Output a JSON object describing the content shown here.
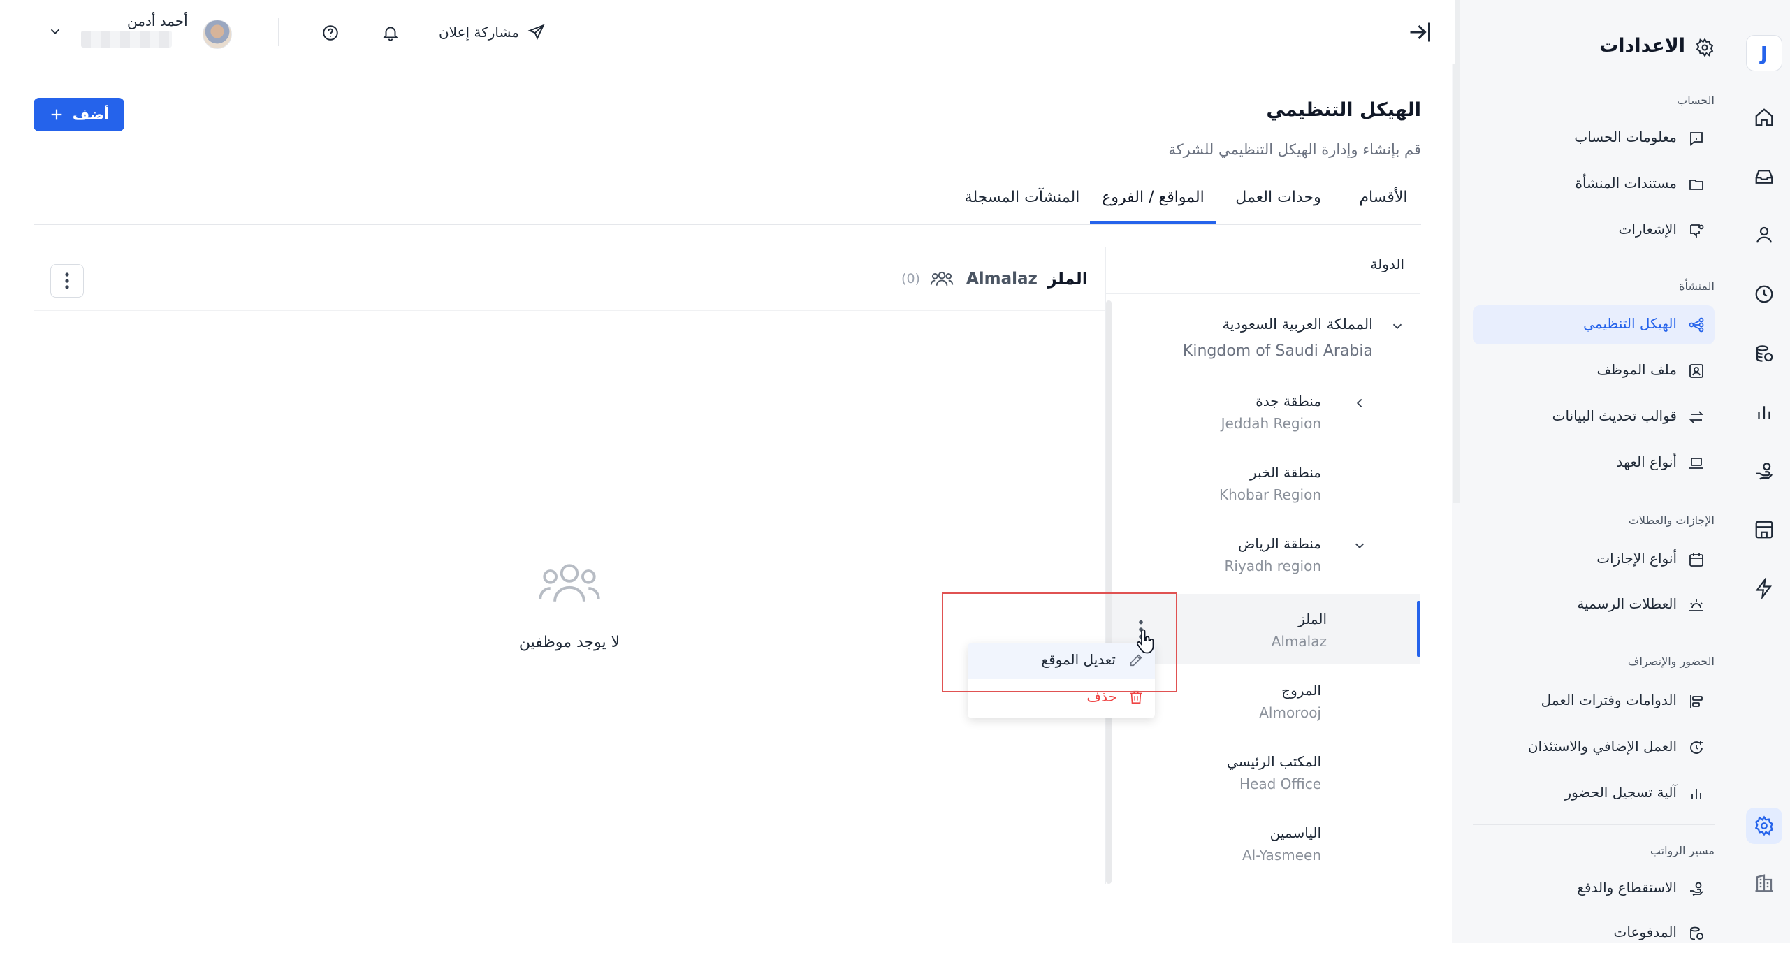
{
  "sidebar": {
    "title": "الاعدادات",
    "sections": [
      {
        "label": "الحساب"
      },
      {
        "label": "المنشأة"
      },
      {
        "label": "الإجازات والعطلات"
      },
      {
        "label": "الحضور والإنصراف"
      },
      {
        "label": "مسير الرواتب"
      }
    ],
    "items": [
      {
        "label": "معلومات الحساب"
      },
      {
        "label": "مستندات المنشأة"
      },
      {
        "label": "الإشعارات"
      },
      {
        "label": "الهيكل التنظيمي",
        "active": true
      },
      {
        "label": "ملف الموظف"
      },
      {
        "label": "قوالب تحديث البيانات"
      },
      {
        "label": "أنواع العهد"
      },
      {
        "label": "أنواع الإجازات"
      },
      {
        "label": "العطلات الرسمية"
      },
      {
        "label": "الدوامات وفترات العمل"
      },
      {
        "label": "العمل الإضافي والاستئذان"
      },
      {
        "label": "آلية تسجيل الحضور"
      },
      {
        "label": "الاستقطاع والدفع"
      },
      {
        "label": "المدفوعات"
      }
    ]
  },
  "topbar": {
    "user_name": "أحمد أدمن",
    "share_label": "مشاركة إعلان"
  },
  "page": {
    "title": "الهيكل التنظيمي",
    "subtitle": "قم بإنشاء وإدارة الهيكل التنظيمي للشركة",
    "add_label": "أضف",
    "tabs": [
      {
        "label": "الأقسام"
      },
      {
        "label": "وحدات العمل"
      },
      {
        "label": "المواقع / الفروع",
        "active": true
      },
      {
        "label": "المنشآت المسجلة"
      }
    ]
  },
  "tree": {
    "header": "الدولة",
    "country_ar": "المملكة العربية السعودية",
    "country_en": "Kingdom of Saudi Arabia",
    "regions": [
      {
        "ar": "منطقة جدة",
        "en": "Jeddah Region"
      },
      {
        "ar": "منطقة الخبر",
        "en": "Khobar Region"
      },
      {
        "ar": "منطقة الرياض",
        "en": "Riyadh region"
      }
    ],
    "locations": [
      {
        "ar": "الملز",
        "en": "Almalaz",
        "selected": true
      },
      {
        "ar": "المروج",
        "en": "Almorooj"
      },
      {
        "ar": "المكتب الرئيسي",
        "en": "Head Office"
      },
      {
        "ar": "الياسمين",
        "en": "Al-Yasmeen"
      }
    ]
  },
  "context_menu": {
    "edit_label": "تعديل الموقع",
    "delete_label": "حذف"
  },
  "employees": {
    "title_ar": "الملز",
    "title_en": "Almalaz",
    "count": "(0)",
    "empty_text": "لا يوجد موظفين"
  },
  "colors": {
    "accent": "#2563eb",
    "danger": "#ef4444",
    "highlight_box": "#e05252",
    "sidebar_bg": "#f6f7f9"
  }
}
